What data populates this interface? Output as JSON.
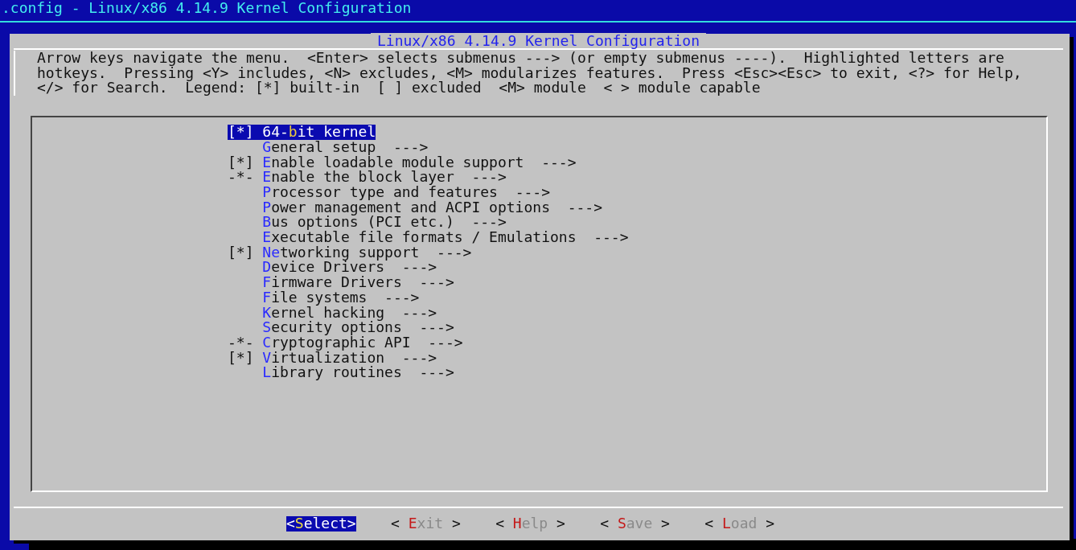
{
  "window": {
    "title": ".config - Linux/x86 4.14.9 Kernel Configuration"
  },
  "dialog": {
    "title": "Linux/x86 4.14.9 Kernel Configuration",
    "help_lines": [
      "Arrow keys navigate the menu.  <Enter> selects submenus ---> (or empty submenus ----).  Highlighted letters are",
      "hotkeys.  Pressing <Y> includes, <N> excludes, <M> modularizes features.  Press <Esc><Esc> to exit, <?> for Help,",
      "</> for Search.  Legend: [*] built-in  [ ] excluded  <M> module  < > module capable"
    ],
    "menu_items": [
      {
        "prefix": "[*]",
        "before": "64-",
        "hotkey": "b",
        "after": "it kernel",
        "selected": true
      },
      {
        "hotkey": "G",
        "after": "eneral setup",
        "arrow": "--->",
        "selected": false
      },
      {
        "prefix": "[*]",
        "hotkey": "E",
        "after": "nable loadable module support",
        "arrow": "--->",
        "selected": false
      },
      {
        "prefix": "-*-",
        "hotkey": "E",
        "after": "nable the block layer",
        "arrow": "--->",
        "selected": false
      },
      {
        "hotkey": "P",
        "after": "rocessor type and features",
        "arrow": "--->",
        "selected": false
      },
      {
        "hotkey": "P",
        "after": "ower management and ACPI options",
        "arrow": "--->",
        "selected": false
      },
      {
        "hotkey": "B",
        "after": "us options (PCI etc.)",
        "arrow": "--->",
        "selected": false
      },
      {
        "hotkey": "E",
        "after": "xecutable file formats / Emulations",
        "arrow": "--->",
        "selected": false
      },
      {
        "prefix": "[*]",
        "hotkey": "Ne",
        "after": "tworking support",
        "arrow": "--->",
        "selected": false
      },
      {
        "hotkey": "D",
        "after": "evice Drivers",
        "arrow": "--->",
        "selected": false
      },
      {
        "hotkey": "F",
        "after": "irmware Drivers",
        "arrow": "--->",
        "selected": false
      },
      {
        "hotkey": "F",
        "after": "ile systems",
        "arrow": "--->",
        "selected": false
      },
      {
        "hotkey": "K",
        "after": "ernel hacking",
        "arrow": "--->",
        "selected": false
      },
      {
        "hotkey": "S",
        "after": "ecurity options",
        "arrow": "--->",
        "selected": false
      },
      {
        "prefix": "-*-",
        "hotkey": "C",
        "after": "ryptographic API",
        "arrow": "--->",
        "selected": false
      },
      {
        "prefix": "[*]",
        "hotkey": "V",
        "after": "irtualization",
        "arrow": "--->",
        "selected": false
      },
      {
        "hotkey": "L",
        "after": "ibrary routines",
        "arrow": "--->",
        "selected": false
      }
    ],
    "buttons": [
      {
        "left": "<",
        "hotkey": "S",
        "rest": "elect",
        "right": ">",
        "selected": true
      },
      {
        "left": "< ",
        "hotkey": "E",
        "rest": "xit",
        "right": " >",
        "selected": false
      },
      {
        "left": "< ",
        "hotkey": "H",
        "rest": "elp",
        "right": " >",
        "selected": false
      },
      {
        "left": "< ",
        "hotkey": "S",
        "rest": "ave",
        "right": " >",
        "selected": false
      },
      {
        "left": "< ",
        "hotkey": "L",
        "rest": "oad",
        "right": " >",
        "selected": false
      }
    ]
  }
}
